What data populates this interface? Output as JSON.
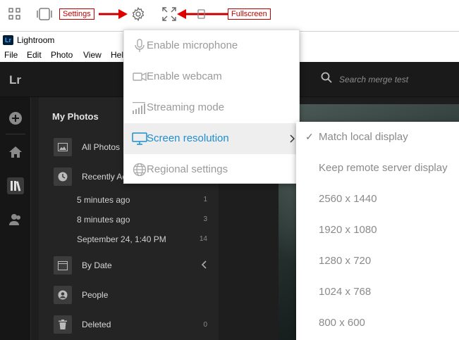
{
  "toolbar": {
    "icons": [
      "grid-icon",
      "tablet-icon",
      "gear-icon",
      "expand-icon",
      "devices-icon"
    ],
    "callouts": {
      "settings": "Settings",
      "fullscreen": "Fullscreen"
    },
    "callout_color": "#c00000"
  },
  "window": {
    "app_icon_text": "Lr",
    "title": "Lightroom",
    "menu": [
      "File",
      "Edit",
      "Photo",
      "View",
      "Hel"
    ]
  },
  "app": {
    "brand_mark": "Lr",
    "search_placeholder": "Search merge test",
    "panel": {
      "heading": "My Photos",
      "all_photos": "All Photos",
      "recently_added": "Recently Ac",
      "recent_items": [
        {
          "label": "5 minutes ago",
          "count": "1"
        },
        {
          "label": "8 minutes ago",
          "count": "3"
        },
        {
          "label": "September 24, 1:40 PM",
          "count": "14"
        }
      ],
      "by_date": "By Date",
      "people": "People",
      "deleted": "Deleted",
      "deleted_count": "0"
    }
  },
  "settings_menu": {
    "accent_color": "#1d8ed0",
    "items": [
      {
        "label": "Enable microphone",
        "icon": "microphone-icon"
      },
      {
        "label": "Enable webcam",
        "icon": "webcam-icon"
      },
      {
        "label": "Streaming mode",
        "icon": "signal-bars-icon"
      },
      {
        "label": "Screen resolution",
        "icon": "monitor-icon",
        "active": true
      },
      {
        "label": "Regional settings",
        "icon": "globe-icon"
      }
    ]
  },
  "resolution_submenu": {
    "selected": "Match local display",
    "items": [
      {
        "label": "Match local display",
        "checked": true
      },
      {
        "label": "Keep remote server display"
      },
      {
        "label": "2560 x 1440"
      },
      {
        "label": "1920 x 1080"
      },
      {
        "label": "1280 x 720"
      },
      {
        "label": "1024 x 768"
      },
      {
        "label": "800 x 600"
      }
    ]
  }
}
